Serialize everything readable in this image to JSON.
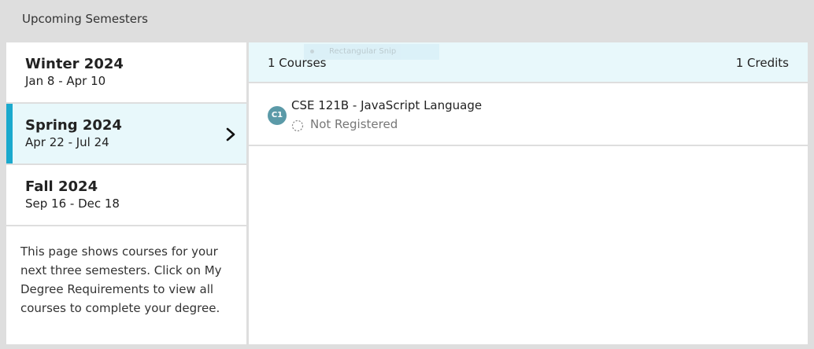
{
  "header": {
    "title": "Upcoming Semesters"
  },
  "semesters": [
    {
      "name": "Winter 2024",
      "dates": "Jan 8 - Apr 10"
    },
    {
      "name": "Spring 2024",
      "dates": "Apr 22 - Jul 24"
    },
    {
      "name": "Fall 2024",
      "dates": "Sep 16 - Dec 18"
    }
  ],
  "info_text": "This page shows courses for your next three semesters. Click on My Degree Requirements to view all courses to complete your degree.",
  "summary": {
    "courses": "1 Courses",
    "credits": "1 Credits"
  },
  "overlay": {
    "snip_label": "Rectangular Snip"
  },
  "courses": [
    {
      "badge": "C1",
      "title": "CSE 121B - JavaScript Language",
      "status": "Not Registered"
    }
  ],
  "colors": {
    "accent": "#1ba9cd",
    "selected_bg": "#e8f8fb",
    "badge": "#5b9aa8"
  },
  "icons": {
    "selected_chevron": "chevron-right-icon",
    "status": "dashed-circle-icon"
  }
}
